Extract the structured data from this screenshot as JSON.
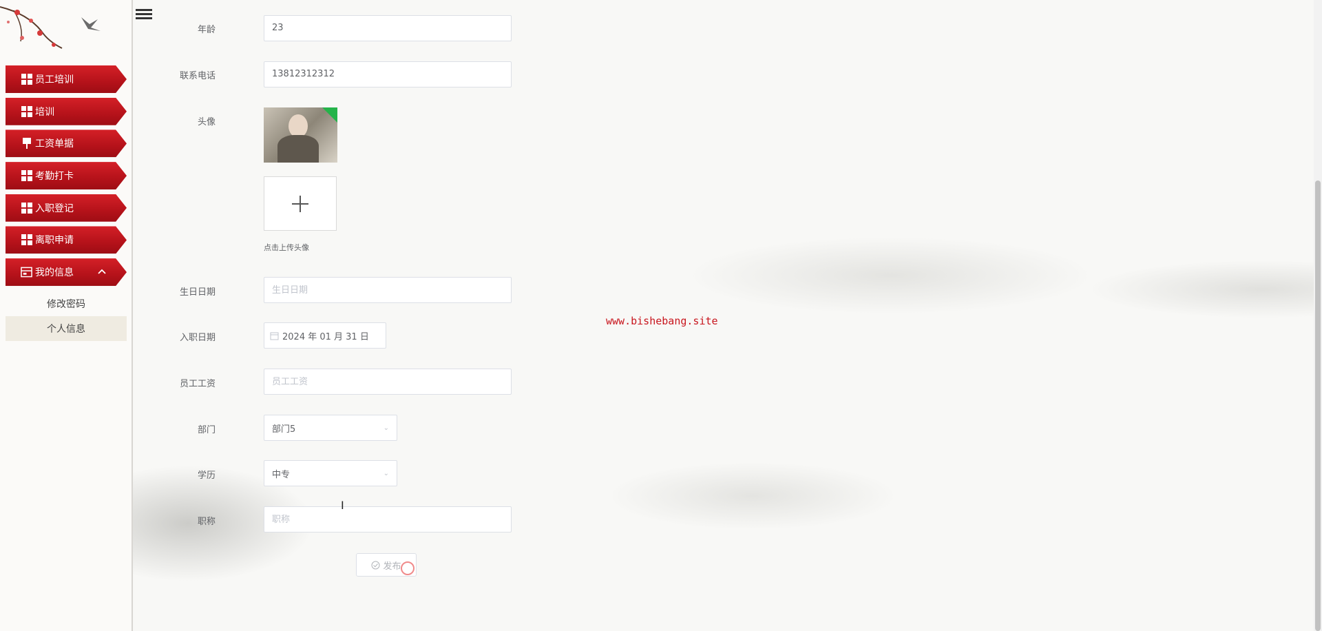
{
  "sidebar": {
    "menu": [
      {
        "label": "员工培训",
        "icon": "grid-icon"
      },
      {
        "label": "培训",
        "icon": "grid-icon"
      },
      {
        "label": "工资单据",
        "icon": "pin-icon"
      },
      {
        "label": "考勤打卡",
        "icon": "grid-icon"
      },
      {
        "label": "入职登记",
        "icon": "grid-icon"
      },
      {
        "label": "离职申请",
        "icon": "grid-icon"
      },
      {
        "label": "我的信息",
        "icon": "card-icon",
        "expanded": true
      }
    ],
    "submenu": [
      {
        "label": "修改密码",
        "active": false
      },
      {
        "label": "个人信息",
        "active": true
      }
    ]
  },
  "form": {
    "age": {
      "label": "年龄",
      "value": "23"
    },
    "phone": {
      "label": "联系电话",
      "value": "13812312312"
    },
    "avatar": {
      "label": "头像",
      "upload_hint": "点击上传头像"
    },
    "birthday": {
      "label": "生日日期",
      "placeholder": "生日日期"
    },
    "join_date": {
      "label": "入职日期",
      "value": "2024 年 01 月 31 日"
    },
    "salary": {
      "label": "员工工资",
      "placeholder": "员工工资"
    },
    "department": {
      "label": "部门",
      "value": "部门5"
    },
    "education": {
      "label": "学历",
      "value": "中专"
    },
    "title": {
      "label": "职称",
      "placeholder": "职称"
    },
    "submit_label": "发布"
  },
  "watermark": "www.bishebang.site",
  "colors": {
    "menu_red": "#c8151d",
    "active_sub_bg": "#efebe1"
  }
}
